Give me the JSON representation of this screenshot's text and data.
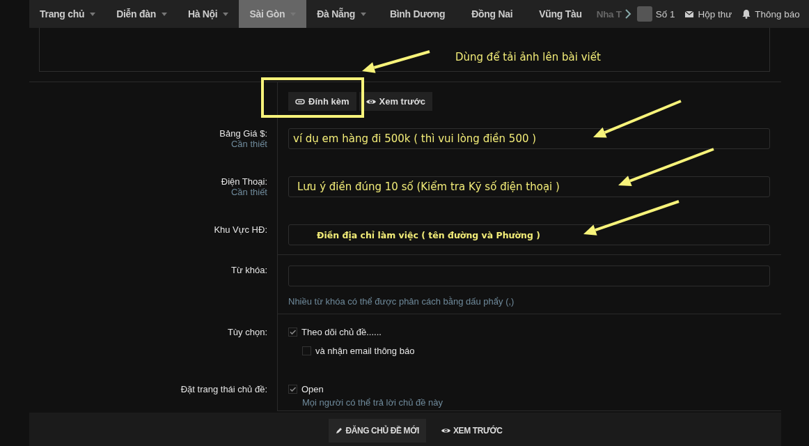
{
  "nav": {
    "tabs": [
      {
        "label": "Trang chủ",
        "dropdown": true,
        "selected": false
      },
      {
        "label": "Diễn đàn",
        "dropdown": true,
        "selected": false
      },
      {
        "label": "Hà Nội",
        "dropdown": true,
        "selected": false
      },
      {
        "label": "Sài Gòn",
        "dropdown": true,
        "selected": true
      },
      {
        "label": "Đà Nẵng",
        "dropdown": true,
        "selected": false
      },
      {
        "label": "Bình Dương",
        "dropdown": false,
        "selected": false
      },
      {
        "label": "Đồng Nai",
        "dropdown": false,
        "selected": false
      },
      {
        "label": "Vũng Tàu",
        "dropdown": false,
        "selected": false
      }
    ],
    "cut_tab": "Nha T",
    "user": "Số 1",
    "links": [
      {
        "kind": "inbox",
        "label": "Hộp thư"
      },
      {
        "kind": "alerts",
        "label": "Thông báo"
      }
    ]
  },
  "editor_buttons": [
    {
      "kind": "attach",
      "label": "Đính kèm"
    },
    {
      "kind": "preview",
      "label": "Xem trước"
    }
  ],
  "fields": [
    {
      "kind": "text",
      "label": "Bảng Giá $:",
      "note": "Cần thiết",
      "value": "ví dụ em hàng đi 500k ( thì vui lòng điền 500 )"
    },
    {
      "kind": "text",
      "label": "Điện Thoại:",
      "note": "Cần thiết",
      "value": "Lưu ý điền đúng 10 số (Kiểm tra Kỹ số điện thoại )"
    },
    {
      "kind": "text",
      "label": "Khu Vực HĐ:",
      "value": "Điền địa chỉ làm việc ( tên đường và Phường )"
    },
    {
      "kind": "text",
      "label": "Từ khóa:",
      "hint": "Nhiều từ khóa có thể được phân cách bằng dấu phẩy (,)"
    },
    {
      "kind": "checks",
      "label": "Tùy chọn:",
      "options": [
        {
          "label": "Theo dõi chủ đề......",
          "checked": true,
          "children": [
            {
              "label": "và nhận email thông báo",
              "checked": false
            }
          ]
        }
      ]
    },
    {
      "kind": "checks",
      "label": "Đặt trang thái chủ đề:",
      "options": [
        {
          "label": "Open",
          "checked": true,
          "note": "Mọi người có thể trả lời chủ đề này"
        }
      ]
    }
  ],
  "footer_buttons": [
    {
      "kind": "submit",
      "label": "ĐĂNG CHỦ ĐỀ MỚI"
    },
    {
      "kind": "preview",
      "label": "XEM TRƯỚC"
    }
  ],
  "annotation": "Dùng để tải ảnh lên bài viết"
}
